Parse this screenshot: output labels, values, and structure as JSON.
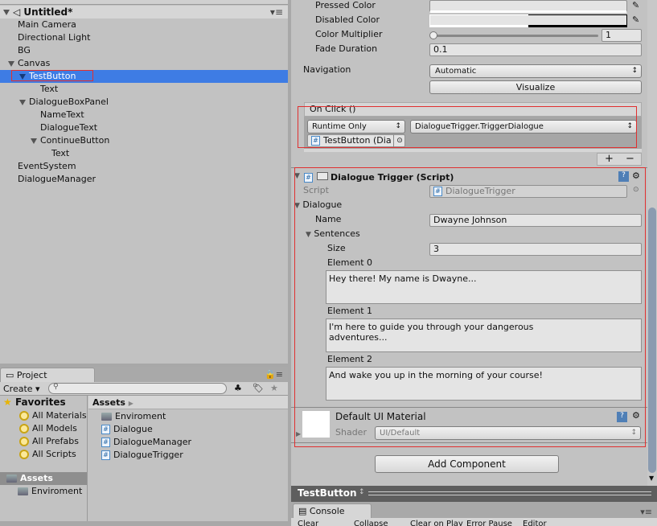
{
  "hierarchy": {
    "scene": "Untitled*",
    "items": [
      {
        "label": "Main Camera",
        "depth": 1
      },
      {
        "label": "Directional Light",
        "depth": 1
      },
      {
        "label": "BG",
        "depth": 1
      },
      {
        "label": "Canvas",
        "depth": 0,
        "expanded": true
      },
      {
        "label": "TestButton",
        "depth": 1,
        "expanded": true,
        "selected": true
      },
      {
        "label": "Text",
        "depth": 3
      },
      {
        "label": "DialogueBoxPanel",
        "depth": 1,
        "expanded": true
      },
      {
        "label": "NameText",
        "depth": 3
      },
      {
        "label": "DialogueText",
        "depth": 3
      },
      {
        "label": "ContinueButton",
        "depth": 2,
        "expanded": true
      },
      {
        "label": "Text",
        "depth": 4
      },
      {
        "label": "EventSystem",
        "depth": 1
      },
      {
        "label": "DialogueManager",
        "depth": 1
      }
    ]
  },
  "project": {
    "tab": "Project",
    "create": "Create",
    "search_placeholder": "",
    "favorites": {
      "label": "Favorites",
      "items": [
        "All Materials",
        "All Models",
        "All Prefabs",
        "All Scripts"
      ]
    },
    "assets_tree": {
      "label": "Assets",
      "items": [
        "Enviroment"
      ]
    },
    "breadcrumb": "Assets",
    "files": [
      {
        "name": "Enviroment",
        "type": "folder"
      },
      {
        "name": "Dialogue",
        "type": "script"
      },
      {
        "name": "DialogueManager",
        "type": "script"
      },
      {
        "name": "DialogueTrigger",
        "type": "script"
      }
    ]
  },
  "inspector": {
    "pressed_color": "Pressed Color",
    "disabled_color": "Disabled Color",
    "color_multiplier": {
      "label": "Color Multiplier",
      "value": "1",
      "slider": 0
    },
    "fade_duration": {
      "label": "Fade Duration",
      "value": "0.1"
    },
    "navigation": {
      "label": "Navigation",
      "value": "Automatic"
    },
    "visualize": "Visualize",
    "on_click": {
      "label": "On Click ()",
      "mode": "Runtime Only",
      "function": "DialogueTrigger.TriggerDialogue",
      "target": "TestButton (Dia",
      "plus": "+",
      "minus": "−"
    },
    "dialogue_trigger": {
      "title": "Dialogue Trigger (Script)",
      "script_label": "Script",
      "script_value": "DialogueTrigger",
      "dialogue_label": "Dialogue",
      "name_label": "Name",
      "name_value": "Dwayne Johnson",
      "sentences_label": "Sentences",
      "size_label": "Size",
      "size_value": "3",
      "elements": [
        {
          "label": "Element 0",
          "value": "Hey there! My name is Dwayne..."
        },
        {
          "label": "Element 1",
          "value": "I'm here to guide you through your dangerous\nadventures..."
        },
        {
          "label": "Element 2",
          "value": "And wake you up in the morning of your course!"
        }
      ]
    },
    "material": {
      "name": "Default UI Material",
      "shader_label": "Shader",
      "shader_value": "UI/Default"
    },
    "add_component": "Add Component"
  },
  "preview": {
    "title": "TestButton"
  },
  "console": {
    "tab": "Console",
    "toolbar": [
      "Clear",
      "Collapse",
      "Clear on Play",
      "Error Pause",
      "Editor"
    ]
  }
}
